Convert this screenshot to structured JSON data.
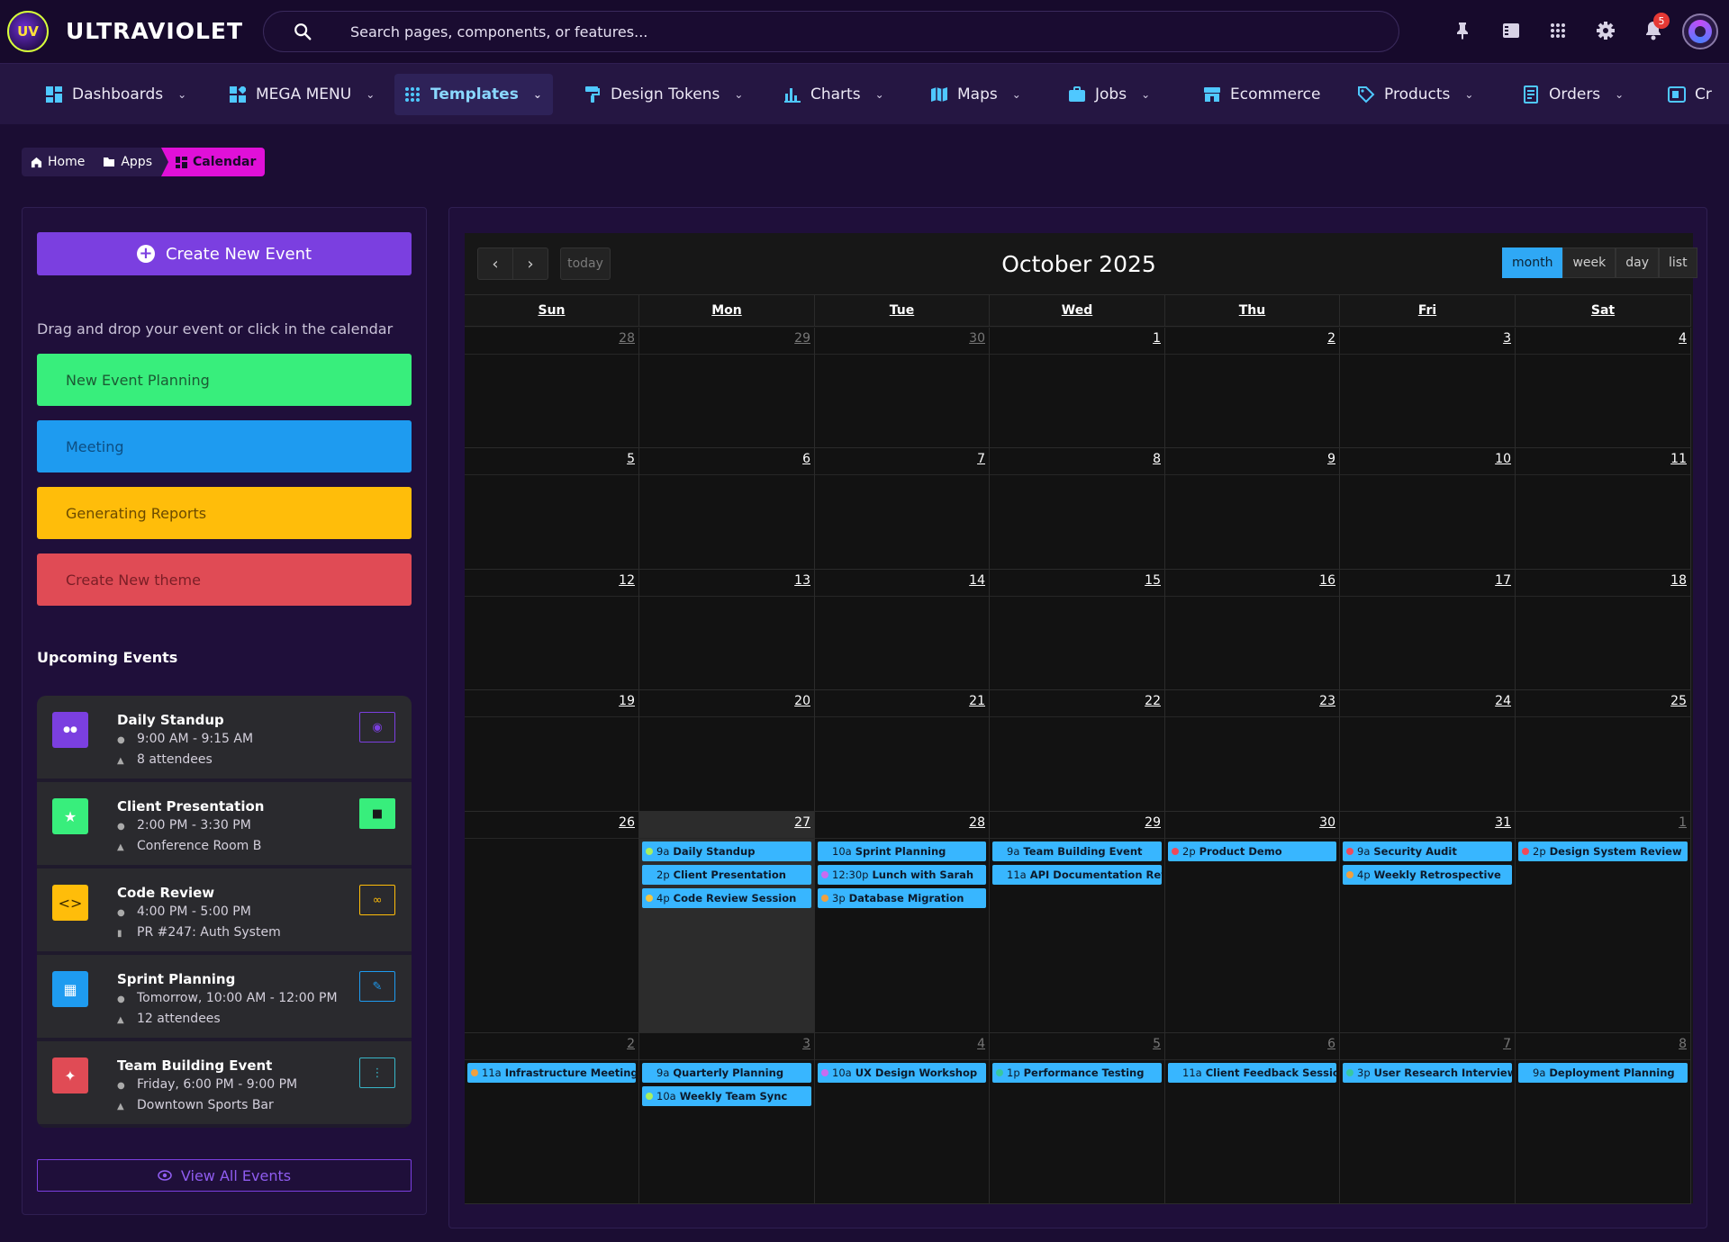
{
  "brand": {
    "name": "ULTRAVIOLET",
    "logo_text": "UV"
  },
  "search": {
    "placeholder": "Search pages, components, or features..."
  },
  "header_icons": [
    "pin-icon",
    "panel-icon",
    "apps-grid-icon",
    "settings-icon",
    "bell-icon"
  ],
  "notifications": {
    "count": "5"
  },
  "nav": [
    {
      "label": "Dashboards",
      "icon": "dashboard-icon",
      "chevron": true
    },
    {
      "label": "MEGA MENU",
      "icon": "mega-menu-icon",
      "chevron": true
    },
    {
      "label": "Templates",
      "icon": "grid-dots-icon",
      "chevron": true,
      "active": true
    },
    {
      "label": "Design Tokens",
      "icon": "paint-roller-icon",
      "chevron": true
    },
    {
      "label": "Charts",
      "icon": "bar-chart-icon",
      "chevron": true
    },
    {
      "label": "Maps",
      "icon": "map-icon",
      "chevron": true
    },
    {
      "label": "Jobs",
      "icon": "briefcase-icon",
      "chevron": true
    },
    {
      "label": "Ecommerce",
      "icon": "store-icon",
      "chevron": false
    },
    {
      "label": "Products",
      "icon": "tag-icon",
      "chevron": true
    },
    {
      "label": "Orders",
      "icon": "receipt-icon",
      "chevron": true
    },
    {
      "label": "Cr",
      "icon": "card-icon",
      "chevron": false
    }
  ],
  "breadcrumb": {
    "home": "Home",
    "apps": "Apps",
    "current": "Calendar"
  },
  "sidebar": {
    "create_button": "Create New Event",
    "drag_hint": "Drag and drop your event or click in the calendar",
    "draggable_events": [
      {
        "label": "New Event Planning",
        "color": "#38ee7c",
        "text_color": "#1b5a34"
      },
      {
        "label": "Meeting",
        "color": "#1e9bf0",
        "text_color": "#0d4e82"
      },
      {
        "label": "Generating Reports",
        "color": "#ffbd0a",
        "text_color": "#6b4a00"
      },
      {
        "label": "Create New theme",
        "color": "#e04b55",
        "text_color": "#7a1e26"
      }
    ],
    "upcoming_title": "Upcoming Events",
    "upcoming": [
      {
        "title": "Daily Standup",
        "line1": "9:00 AM - 9:15 AM",
        "line2": "8 attendees",
        "icon": "users-icon",
        "icon_bg": "#7b3fe0",
        "action_icon": "eye-icon",
        "action_style": "outline",
        "action_color": "#7b3fe0"
      },
      {
        "title": "Client Presentation",
        "line1": "2:00 PM - 3:30 PM",
        "line2": "Conference Room B",
        "icon": "star-icon",
        "icon_bg": "#38ee7c",
        "action_icon": "video-icon",
        "action_style": "solid",
        "action_color": "#38ee7c"
      },
      {
        "title": "Code Review",
        "line1": "4:00 PM - 5:00 PM",
        "line2": "PR #247: Auth System",
        "icon": "code-icon",
        "icon_bg": "#ffbd0a",
        "action_icon": "link-icon",
        "action_style": "outline",
        "action_color": "#ffbd0a"
      },
      {
        "title": "Sprint Planning",
        "line1": "Tomorrow, 10:00 AM - 12:00 PM",
        "line2": "12 attendees",
        "icon": "calendar-icon",
        "icon_bg": "#1e9bf0",
        "action_icon": "pencil-icon",
        "action_style": "outline",
        "action_color": "#1e9bf0"
      },
      {
        "title": "Team Building Event",
        "line1": "Friday, 6:00 PM - 9:00 PM",
        "line2": "Downtown Sports Bar",
        "icon": "party-icon",
        "icon_bg": "#e04b55",
        "action_icon": "more-vertical-icon",
        "action_style": "outline",
        "action_color": "#38b6c8"
      }
    ],
    "view_all": "View All Events"
  },
  "calendar": {
    "title": "October 2025",
    "today_label": "today",
    "views": [
      "month",
      "week",
      "day",
      "list"
    ],
    "active_view": "month",
    "weekdays": [
      "Sun",
      "Mon",
      "Tue",
      "Wed",
      "Thu",
      "Fri",
      "Sat"
    ],
    "weeks": [
      [
        {
          "d": "28",
          "other": true
        },
        {
          "d": "29",
          "other": true
        },
        {
          "d": "30",
          "other": true
        },
        {
          "d": "1"
        },
        {
          "d": "2"
        },
        {
          "d": "3"
        },
        {
          "d": "4"
        }
      ],
      [
        {
          "d": "5"
        },
        {
          "d": "6"
        },
        {
          "d": "7"
        },
        {
          "d": "8"
        },
        {
          "d": "9"
        },
        {
          "d": "10"
        },
        {
          "d": "11"
        }
      ],
      [
        {
          "d": "12"
        },
        {
          "d": "13"
        },
        {
          "d": "14"
        },
        {
          "d": "15"
        },
        {
          "d": "16"
        },
        {
          "d": "17"
        },
        {
          "d": "18"
        }
      ],
      [
        {
          "d": "19"
        },
        {
          "d": "20"
        },
        {
          "d": "21"
        },
        {
          "d": "22"
        },
        {
          "d": "23"
        },
        {
          "d": "24"
        },
        {
          "d": "25"
        }
      ],
      [
        {
          "d": "26"
        },
        {
          "d": "27",
          "today": true,
          "events": [
            {
              "time": "9a",
              "title": "Daily Standup",
              "dot": "#a8f060"
            },
            {
              "time": "2p",
              "title": "Client Presentation",
              "dot": "#38b6ff"
            },
            {
              "time": "4p",
              "title": "Code Review Session",
              "dot": "#f5c542"
            }
          ]
        },
        {
          "d": "28",
          "events": [
            {
              "time": "10a",
              "title": "Sprint Planning",
              "dot": "#38b6ff"
            },
            {
              "time": "12:30p",
              "title": "Lunch with Sarah",
              "dot": "#c86cf0"
            },
            {
              "time": "3p",
              "title": "Database Migration",
              "dot": "#f0a040"
            }
          ]
        },
        {
          "d": "29",
          "events": [
            {
              "time": "9a",
              "title": "Team Building Event",
              "dot": "#38b6ff"
            },
            {
              "time": "11a",
              "title": "API Documentation Review",
              "dot": "#38b6ff"
            }
          ]
        },
        {
          "d": "30",
          "events": [
            {
              "time": "2p",
              "title": "Product Demo",
              "dot": "#f04a5a"
            }
          ]
        },
        {
          "d": "31",
          "events": [
            {
              "time": "9a",
              "title": "Security Audit",
              "dot": "#f04a5a"
            },
            {
              "time": "4p",
              "title": "Weekly Retrospective",
              "dot": "#f0a040"
            }
          ]
        },
        {
          "d": "1",
          "other": true,
          "events": [
            {
              "time": "2p",
              "title": "Design System Review",
              "dot": "#f04a5a"
            }
          ]
        }
      ],
      [
        {
          "d": "2",
          "other": true,
          "events": [
            {
              "time": "11a",
              "title": "Infrastructure Meeting",
              "dot": "#f0a040"
            }
          ]
        },
        {
          "d": "3",
          "other": true,
          "events": [
            {
              "time": "9a",
              "title": "Quarterly Planning",
              "dot": "#38b6ff"
            },
            {
              "time": "10a",
              "title": "Weekly Team Sync",
              "dot": "#a8f060"
            }
          ]
        },
        {
          "d": "4",
          "other": true,
          "events": [
            {
              "time": "10a",
              "title": "UX Design Workshop",
              "dot": "#c86cf0"
            }
          ]
        },
        {
          "d": "5",
          "other": true,
          "events": [
            {
              "time": "1p",
              "title": "Performance Testing",
              "dot": "#38c8a0"
            }
          ]
        },
        {
          "d": "6",
          "other": true,
          "events": [
            {
              "time": "11a",
              "title": "Client Feedback Session",
              "dot": "#38b6ff"
            }
          ]
        },
        {
          "d": "7",
          "other": true,
          "events": [
            {
              "time": "3p",
              "title": "User Research Interview",
              "dot": "#38c8a0"
            }
          ]
        },
        {
          "d": "8",
          "other": true,
          "events": [
            {
              "time": "9a",
              "title": "Deployment Planning",
              "dot": "#38b6ff"
            }
          ]
        }
      ]
    ]
  }
}
